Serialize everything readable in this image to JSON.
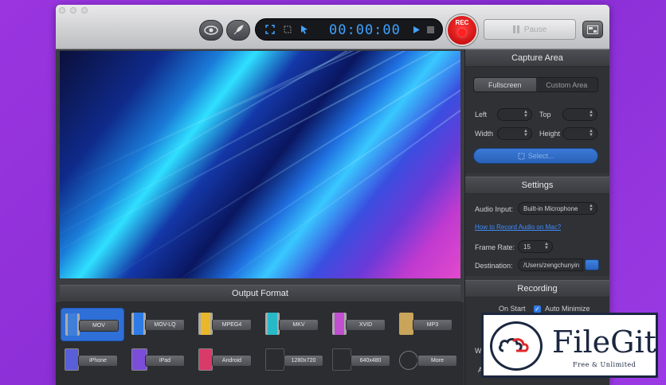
{
  "toolbar": {
    "timer": "00:00:00",
    "rec_label": "REC",
    "pause_label": "Pause"
  },
  "capture_area": {
    "title": "Capture Area",
    "modes": [
      "Fullscreen",
      "Custom Area"
    ],
    "active_mode": "Fullscreen",
    "left_label": "Left",
    "top_label": "Top",
    "width_label": "Width",
    "height_label": "Height",
    "select_label": "Select..."
  },
  "settings": {
    "title": "Settings",
    "audio_input_label": "Audio Input:",
    "audio_input_value": "Built-in Microphone",
    "audio_help_link": "How to Record Audio on Mac?",
    "frame_rate_label": "Frame Rate:",
    "frame_rate_value": "15",
    "destination_label": "Destination:",
    "destination_value": "/Users/zengchunyin"
  },
  "recording": {
    "title": "Recording",
    "on_start_label": "On Start",
    "auto_minimize_label": "Auto Minimize",
    "auto_minimize_checked": true,
    "partial_label_1": "W",
    "partial_label_2": "A"
  },
  "output_format": {
    "title": "Output Format",
    "row1": [
      "MOV",
      "MOV-LQ",
      "MPEG4",
      "MKV",
      "XVID",
      "MP3"
    ],
    "row2": [
      "iPhone",
      "iPad",
      "Android",
      "1280x720",
      "640x480",
      "More"
    ],
    "selected": "MOV"
  },
  "watermark": {
    "brand": "FileGit",
    "tagline": "Free & Unlimited"
  },
  "colors": {
    "accent": "#2e6fd8",
    "timer": "#3fa3ff",
    "rec": "#e00000",
    "link": "#3f8cff"
  }
}
